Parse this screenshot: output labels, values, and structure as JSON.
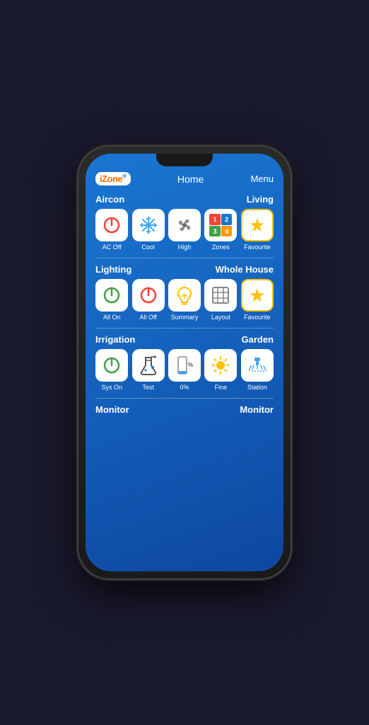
{
  "header": {
    "logo_text": "iZone",
    "title": "Home",
    "menu": "Menu"
  },
  "sections": {
    "aircon": {
      "label": "Aircon",
      "sublabel": "Living",
      "items": [
        {
          "id": "ac-off",
          "label": "AC Off",
          "icon": "power-off-red"
        },
        {
          "id": "cool",
          "label": "Cool",
          "icon": "snowflake"
        },
        {
          "id": "high",
          "label": "High",
          "icon": "fan"
        },
        {
          "id": "zones",
          "label": "Zones",
          "icon": "zones"
        },
        {
          "id": "favourite",
          "label": "Favourite",
          "icon": "star"
        }
      ]
    },
    "lighting": {
      "label": "Lighting",
      "sublabel": "Whole House",
      "items": [
        {
          "id": "all-on",
          "label": "All On",
          "icon": "power-green"
        },
        {
          "id": "all-off",
          "label": "All Off",
          "icon": "power-red"
        },
        {
          "id": "summary",
          "label": "Summary",
          "icon": "bulb"
        },
        {
          "id": "layout",
          "label": "Layout",
          "icon": "grid"
        },
        {
          "id": "favourite2",
          "label": "Favourite",
          "icon": "star"
        }
      ]
    },
    "irrigation": {
      "label": "Irrigation",
      "sublabel": "Garden",
      "items": [
        {
          "id": "sys-on",
          "label": "Sys On",
          "icon": "power-green"
        },
        {
          "id": "test",
          "label": "Test",
          "icon": "beaker"
        },
        {
          "id": "percent",
          "label": "0%",
          "icon": "percent"
        },
        {
          "id": "fine",
          "label": "Fine",
          "icon": "sun"
        },
        {
          "id": "station",
          "label": "Station",
          "icon": "station"
        }
      ]
    },
    "monitor": {
      "label": "Monitor",
      "sublabel": "Monitor"
    }
  }
}
